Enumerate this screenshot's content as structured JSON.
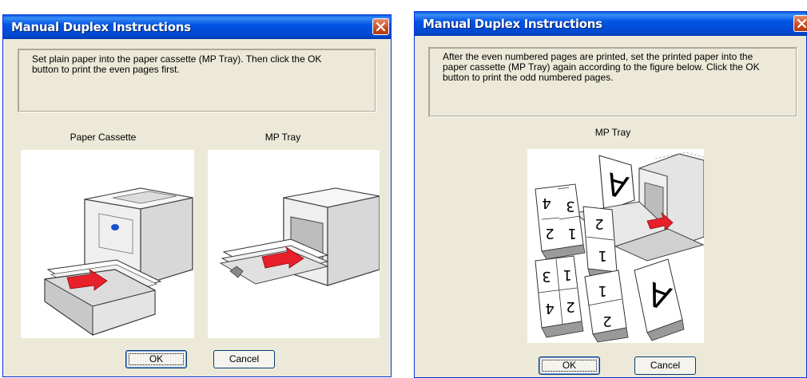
{
  "left_dialog": {
    "title": "Manual Duplex Instructions",
    "message_line1": "Set plain paper into the paper cassette (MP Tray). Then click the OK",
    "message_line2": "button to print the even pages first.",
    "label_cassette": "Paper Cassette",
    "label_mptray": "MP Tray",
    "ok_label": "OK",
    "cancel_label": "Cancel"
  },
  "right_dialog": {
    "title": "Manual Duplex Instructions",
    "message_line1": "After the even numbered pages are printed, set the printed paper into the",
    "message_line2": "paper cassette (MP Tray) again according to the figure below. Click the OK",
    "message_line3": "button to print the odd numbered pages.",
    "label_mptray": "MP Tray",
    "page_a_glyph": "A",
    "page_digits": [
      "4",
      "3",
      "2",
      "1",
      "2",
      "1",
      "3",
      "4",
      "1",
      "2",
      "1",
      "2"
    ],
    "ok_label": "OK",
    "cancel_label": "Cancel"
  },
  "colors": {
    "titlebar": "#0054e3",
    "dialog_bg": "#ece9d8",
    "close": "#c84b22",
    "arrow": "#e8202a",
    "cassette_dot": "#1a4fd0"
  }
}
